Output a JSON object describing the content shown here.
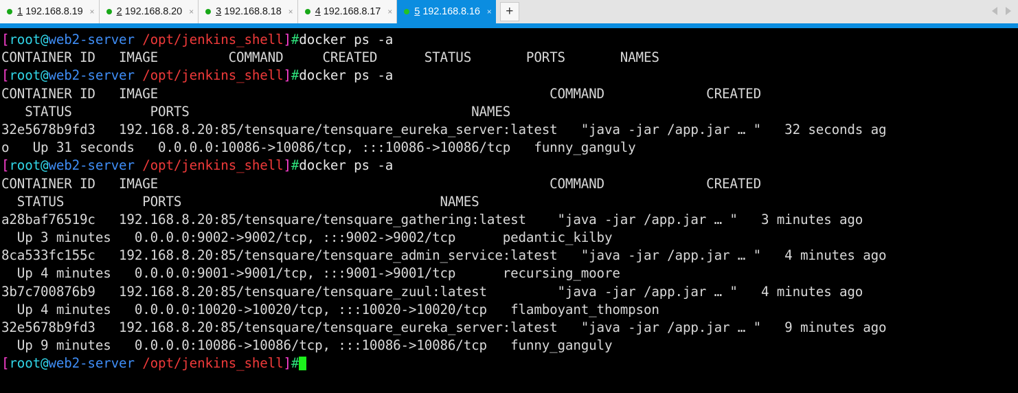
{
  "window": {
    "tabs": [
      {
        "index": "1",
        "address": "192.168.8.19",
        "status": "connected",
        "active": false,
        "close_label": "×"
      },
      {
        "index": "2",
        "address": "192.168.8.20",
        "status": "connected",
        "active": false,
        "close_label": "×"
      },
      {
        "index": "3",
        "address": "192.168.8.18",
        "status": "connected",
        "active": false,
        "close_label": "×"
      },
      {
        "index": "4",
        "address": "192.168.8.17",
        "status": "connected",
        "active": false,
        "close_label": "×"
      },
      {
        "index": "5",
        "address": "192.168.8.16",
        "status": "connected",
        "active": true,
        "close_label": "×"
      }
    ],
    "new_tab_label": "+",
    "accent_color": "#0b8de0",
    "tab_bg": "#f7f7f7",
    "tabbar_bg": "#e4e4e4"
  },
  "terminal": {
    "colors": {
      "background": "#000000",
      "foreground": "#d9d9d9",
      "bracket": "#ff3fd2",
      "user": "#31d6e8",
      "host": "#3f8ef7",
      "path": "#f03a3a",
      "hash": "#2de07a",
      "cursor": "#1cf01c"
    },
    "prompt": {
      "open_bracket": "[",
      "user": "root@",
      "host": "web2-server",
      "space": " ",
      "path": "/opt/jenkins_shell",
      "close_bracket": "]",
      "hash": "#"
    },
    "command": "docker ps -a",
    "lines": [
      {
        "type": "prompt",
        "command": "docker ps -a"
      },
      {
        "type": "output",
        "text": "CONTAINER ID   IMAGE         COMMAND     CREATED      STATUS       PORTS       NAMES"
      },
      {
        "type": "prompt",
        "command": "docker ps -a"
      },
      {
        "type": "output",
        "text": "CONTAINER ID   IMAGE                                                  COMMAND             CREATED"
      },
      {
        "type": "output",
        "text": "   STATUS          PORTS                                    NAMES"
      },
      {
        "type": "output",
        "text": "32e5678b9fd3   192.168.8.20:85/tensquare/tensquare_eureka_server:latest   \"java -jar /app.jar … \"   32 seconds ag"
      },
      {
        "type": "output",
        "text": "o   Up 31 seconds   0.0.0.0:10086->10086/tcp, :::10086->10086/tcp   funny_ganguly"
      },
      {
        "type": "prompt",
        "command": "docker ps -a"
      },
      {
        "type": "output",
        "text": "CONTAINER ID   IMAGE                                                  COMMAND             CREATED"
      },
      {
        "type": "output",
        "text": "  STATUS          PORTS                                 NAMES"
      },
      {
        "type": "output",
        "text": "a28baf76519c   192.168.8.20:85/tensquare/tensquare_gathering:latest    \"java -jar /app.jar … \"   3 minutes ago"
      },
      {
        "type": "output",
        "text": "  Up 3 minutes   0.0.0.0:9002->9002/tcp, :::9002->9002/tcp      pedantic_kilby"
      },
      {
        "type": "output",
        "text": "8ca533fc155c   192.168.8.20:85/tensquare/tensquare_admin_service:latest   \"java -jar /app.jar … \"   4 minutes ago"
      },
      {
        "type": "output",
        "text": "  Up 4 minutes   0.0.0.0:9001->9001/tcp, :::9001->9001/tcp      recursing_moore"
      },
      {
        "type": "output",
        "text": "3b7c700876b9   192.168.8.20:85/tensquare/tensquare_zuul:latest         \"java -jar /app.jar … \"   4 minutes ago"
      },
      {
        "type": "output",
        "text": "  Up 4 minutes   0.0.0.0:10020->10020/tcp, :::10020->10020/tcp   flamboyant_thompson"
      },
      {
        "type": "output",
        "text": "32e5678b9fd3   192.168.8.20:85/tensquare/tensquare_eureka_server:latest   \"java -jar /app.jar … \"   9 minutes ago"
      },
      {
        "type": "output",
        "text": "  Up 9 minutes   0.0.0.0:10086->10086/tcp, :::10086->10086/tcp   funny_ganguly"
      },
      {
        "type": "prompt",
        "command": "",
        "cursor": true
      }
    ],
    "containers": [
      {
        "container_id": "32e5678b9fd3",
        "image": "192.168.8.20:85/tensquare/tensquare_eureka_server:latest",
        "command": "\"java -jar /app.jar … \"",
        "created": "32 seconds ago",
        "status": "Up 31 seconds",
        "ports": "0.0.0.0:10086->10086/tcp, :::10086->10086/tcp",
        "names": "funny_ganguly"
      },
      {
        "container_id": "a28baf76519c",
        "image": "192.168.8.20:85/tensquare/tensquare_gathering:latest",
        "command": "\"java -jar /app.jar … \"",
        "created": "3 minutes ago",
        "status": "Up 3 minutes",
        "ports": "0.0.0.0:9002->9002/tcp, :::9002->9002/tcp",
        "names": "pedantic_kilby"
      },
      {
        "container_id": "8ca533fc155c",
        "image": "192.168.8.20:85/tensquare/tensquare_admin_service:latest",
        "command": "\"java -jar /app.jar … \"",
        "created": "4 minutes ago",
        "status": "Up 4 minutes",
        "ports": "0.0.0.0:9001->9001/tcp, :::9001->9001/tcp",
        "names": "recursing_moore"
      },
      {
        "container_id": "3b7c700876b9",
        "image": "192.168.8.20:85/tensquare/tensquare_zuul:latest",
        "command": "\"java -jar /app.jar … \"",
        "created": "4 minutes ago",
        "status": "Up 4 minutes",
        "ports": "0.0.0.0:10020->10020/tcp, :::10020->10020/tcp",
        "names": "flamboyant_thompson"
      },
      {
        "container_id": "32e5678b9fd3",
        "image": "192.168.8.20:85/tensquare/tensquare_eureka_server:latest",
        "command": "\"java -jar /app.jar … \"",
        "created": "9 minutes ago",
        "status": "Up 9 minutes",
        "ports": "0.0.0.0:10086->10086/tcp, :::10086->10086/tcp",
        "names": "funny_ganguly"
      }
    ]
  }
}
